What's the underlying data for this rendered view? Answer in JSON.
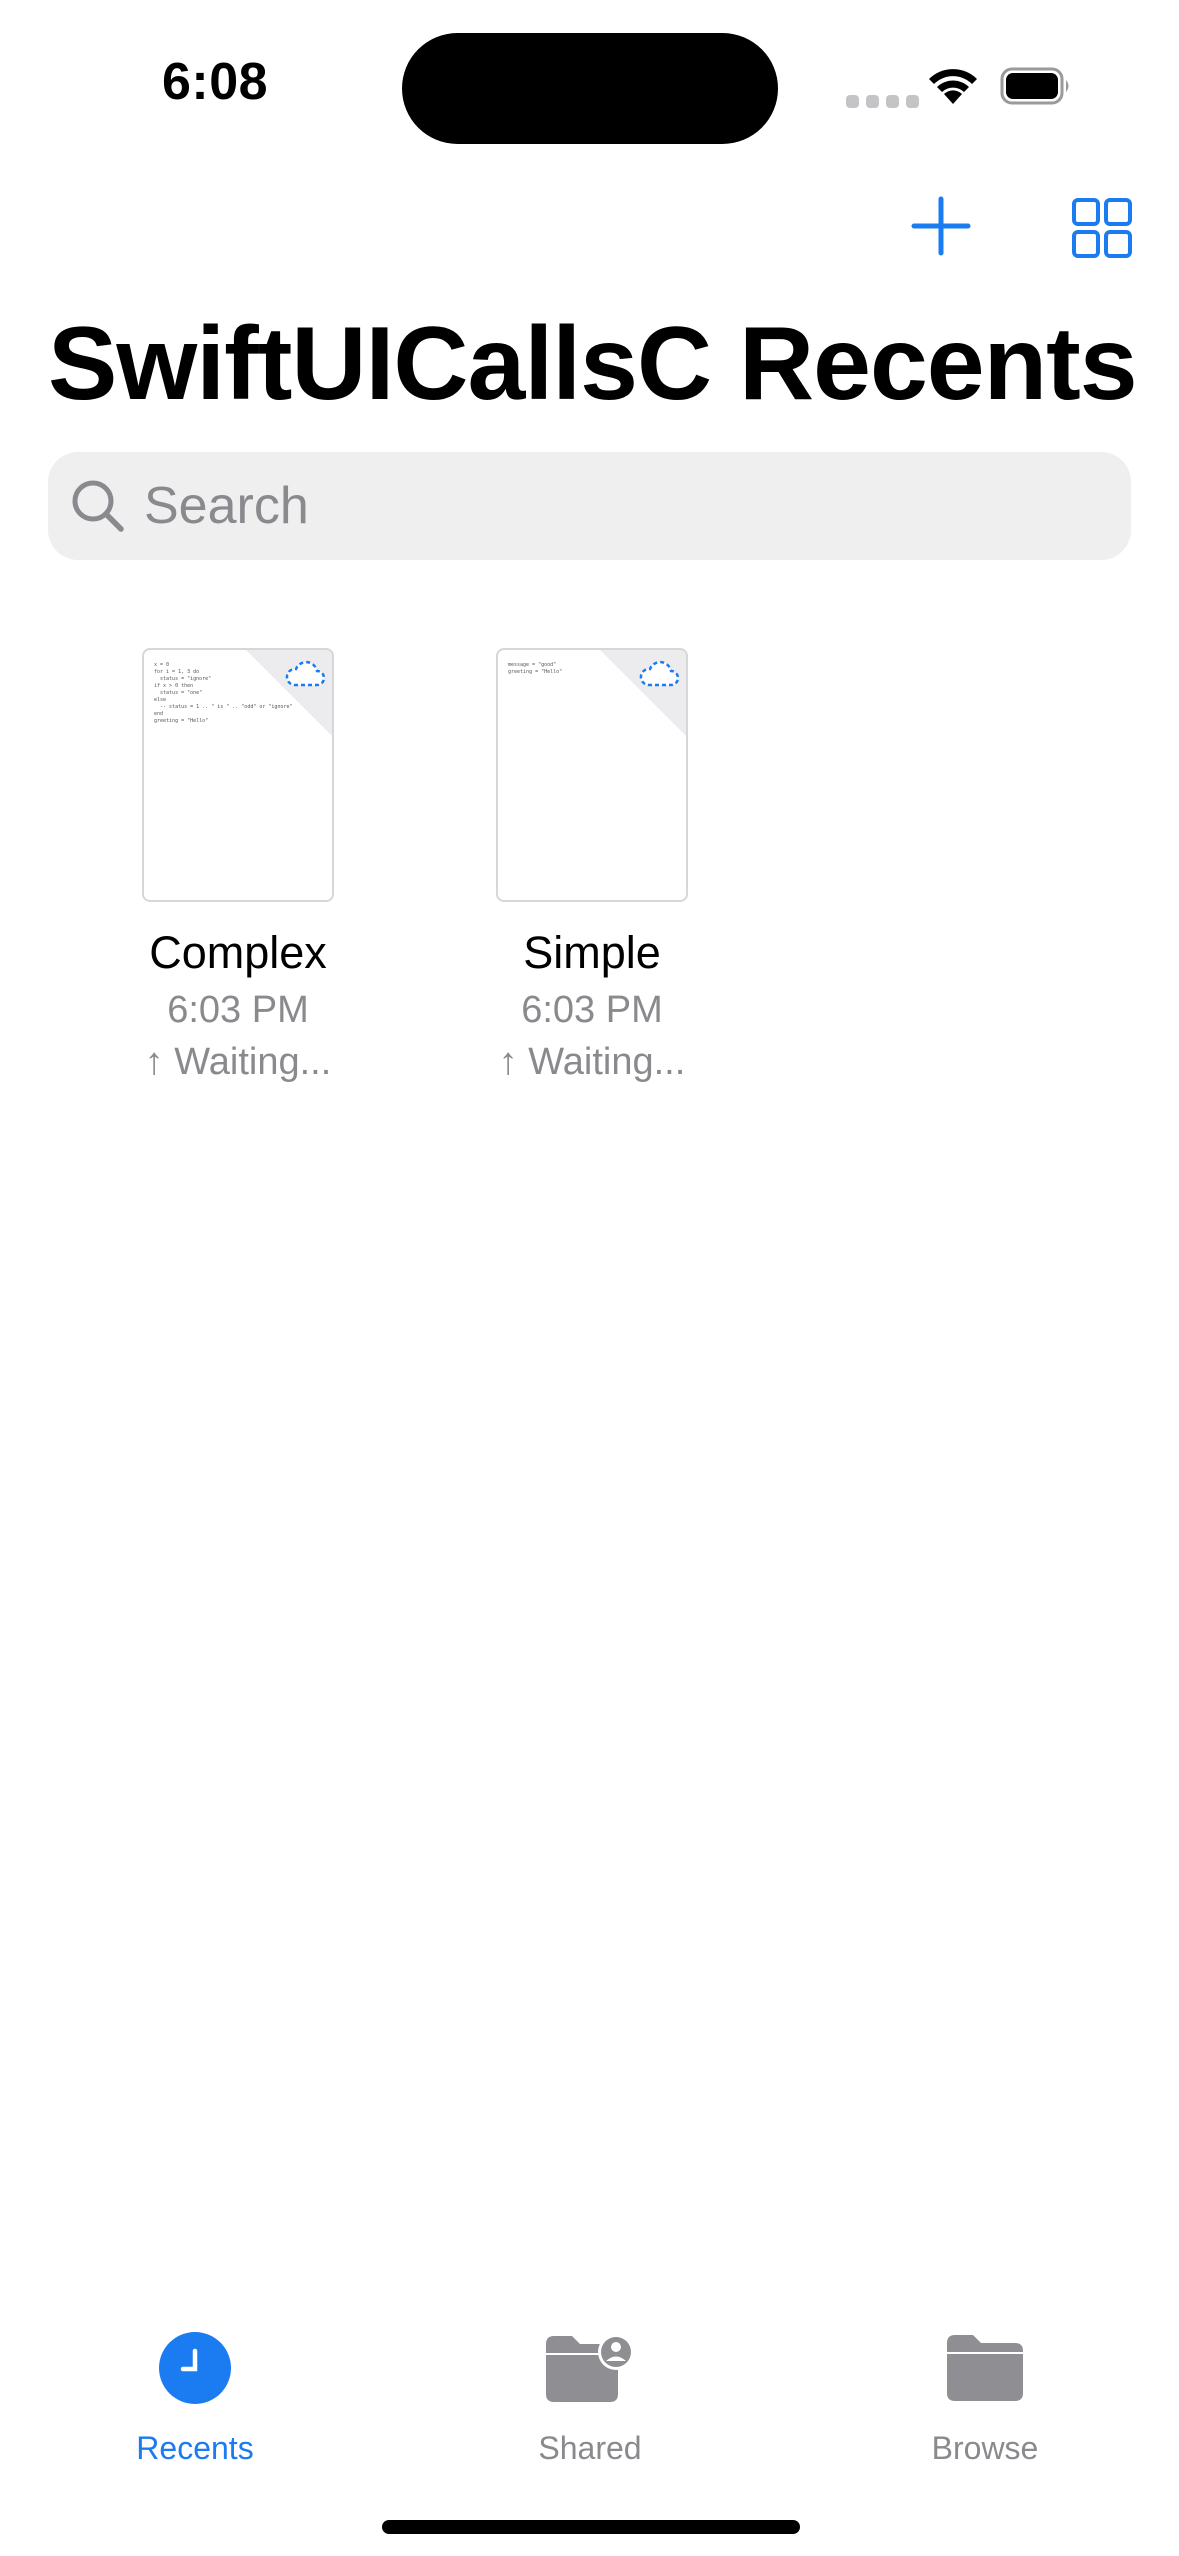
{
  "status_bar": {
    "time": "6:08"
  },
  "toolbar": {
    "add_icon": "plus-icon",
    "layout_icon": "grid-icon"
  },
  "title": "SwiftUICallsC Recents",
  "search": {
    "placeholder": "Search"
  },
  "files": [
    {
      "name": "Complex",
      "time": "6:03 PM",
      "status": "↑ Waiting...",
      "preview": "x = 0\nfor i = 1, 3 do\n  status = \"ignore\"\nif x > 0 then\n  status = \"one\"\nelse\n  -- status = 1 .. \" is \" .. \"odd\" or \"ignore\"\nend\ngreeting = \"Hello\""
    },
    {
      "name": "Simple",
      "time": "6:03 PM",
      "status": "↑ Waiting...",
      "preview": "message = \"good\"\ngreeting = \"Hello\""
    }
  ],
  "tabs": [
    {
      "label": "Recents",
      "icon": "clock-icon",
      "active": true
    },
    {
      "label": "Shared",
      "icon": "shared-folder-icon",
      "active": false
    },
    {
      "label": "Browse",
      "icon": "folder-icon",
      "active": false
    }
  ],
  "colors": {
    "accent": "#1a7cf0",
    "secondary_text": "#8a8a8e",
    "search_bg": "#efeff0",
    "tab_inactive": "#8a8a8e"
  }
}
